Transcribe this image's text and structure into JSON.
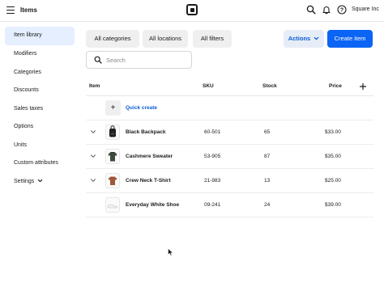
{
  "topbar": {
    "title": "Items",
    "account_name": "Square Inc",
    "icons": [
      "hamburger-icon",
      "square-logo",
      "search-icon",
      "bell-icon",
      "help-icon"
    ]
  },
  "sidebar": {
    "items": [
      {
        "label": "Item library",
        "active": true
      },
      {
        "label": "Modifiers"
      },
      {
        "label": "Categories"
      },
      {
        "label": "Discounts"
      },
      {
        "label": "Sales taxes"
      },
      {
        "label": "Options"
      },
      {
        "label": "Units"
      },
      {
        "label": "Custom attributes"
      },
      {
        "label": "Settings",
        "has_chevron": true
      }
    ]
  },
  "toolbar": {
    "all_categories": "All categories",
    "all_locations": "All locations",
    "all_filters": "All filters",
    "actions": "Actions",
    "create_item": "Create item"
  },
  "search": {
    "placeholder": "Search",
    "value": ""
  },
  "table": {
    "headers": {
      "item": "Item",
      "sku": "SKU",
      "stock": "Stock",
      "price": "Price"
    },
    "quick_create": "Quick create",
    "rows": [
      {
        "name": "Black Backpack",
        "sku": "60-501",
        "stock": "65",
        "price": "$33.00",
        "image": "backpack-icon",
        "expandable": true
      },
      {
        "name": "Cashmere Sweater",
        "sku": "53-905",
        "stock": "87",
        "price": "$35.00",
        "image": "sweater-icon",
        "expandable": true
      },
      {
        "name": "Crew Neck T-Shirt",
        "sku": "21-983",
        "stock": "13",
        "price": "$25.00",
        "image": "tshirt-icon",
        "expandable": true
      },
      {
        "name": "Everyday White Shoe",
        "sku": "09-241",
        "stock": "24",
        "price": "$39.00",
        "image": "shoe-icon",
        "expandable": false
      }
    ]
  },
  "colors": {
    "primary": "#0b64f4",
    "active_nav_bg": "#e5efff",
    "link": "#0b5cd6"
  }
}
